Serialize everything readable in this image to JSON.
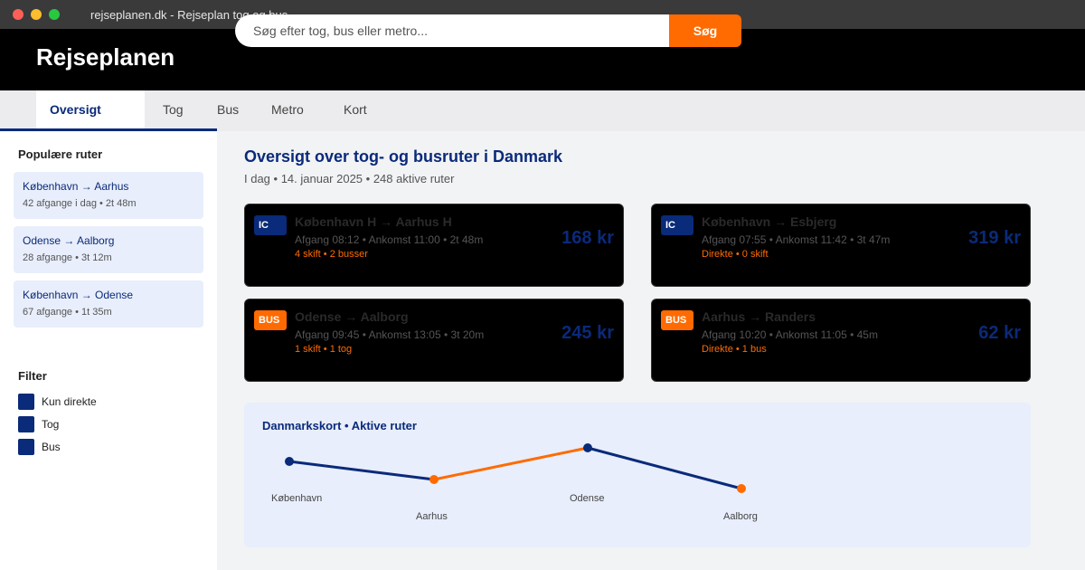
{
  "window": {
    "title": "rejseplanen.dk - Rejseplan tog og bus"
  },
  "header": {
    "logo": "Rejseplanen",
    "search_placeholder": "Søg efter tog, bus eller metro...",
    "search_button": "Søg"
  },
  "tabs": [
    {
      "label": "Oversigt",
      "active": true
    },
    {
      "label": "Tog"
    },
    {
      "label": "Bus"
    },
    {
      "label": "Metro"
    },
    {
      "label": "Kort"
    }
  ],
  "sidebar": {
    "popular_heading": "Populære ruter",
    "routes": [
      {
        "title": "København → Aarhus",
        "sub": "42 afgange i dag • 2t 48m"
      },
      {
        "title": "Odense → Aalborg",
        "sub": "28 afgange • 3t 12m"
      },
      {
        "title": "København → Odense",
        "sub": "67 afgange • 1t 35m"
      }
    ],
    "filter_heading": "Filter",
    "filters": [
      {
        "label": "Kun direkte"
      },
      {
        "label": "Tog"
      },
      {
        "label": "Bus"
      }
    ]
  },
  "main": {
    "title": "Oversigt over tog- og busruter i Danmark",
    "subtitle": "I dag • 14. januar 2025 • 248 aktive ruter",
    "cards": [
      {
        "badge": "IC",
        "type": "ic",
        "title": "København H → Aarhus H",
        "times": "Afgang 08:12 • Ankomst 11:00 • 2t 48m",
        "note": "4 skift • 2 busser",
        "price": "168 kr"
      },
      {
        "badge": "IC",
        "type": "ic",
        "title": "København → Esbjerg",
        "times": "Afgang 07:55 • Ankomst 11:42 • 3t 47m",
        "note": "Direkte • 0 skift",
        "price": "319 kr"
      },
      {
        "badge": "BUS",
        "type": "bus",
        "title": "Odense → Aalborg",
        "times": "Afgang 09:45 • Ankomst 13:05 • 3t 20m",
        "note": "1 skift • 1 tog",
        "price": "245 kr"
      },
      {
        "badge": "BUS",
        "type": "bus",
        "title": "Aarhus → Randers",
        "times": "Afgang 10:20 • Ankomst 11:05 • 45m",
        "note": "Direkte • 1 bus",
        "price": "62 kr"
      }
    ]
  },
  "map": {
    "title": "Danmarkskort • Aktive ruter",
    "cities": [
      {
        "name": "København",
        "color": "#0a2a7a"
      },
      {
        "name": "Aarhus",
        "color": "#ff6b00"
      },
      {
        "name": "Odense",
        "color": "#0a2a7a"
      },
      {
        "name": "Aalborg",
        "color": "#ff6b00"
      }
    ],
    "segment_colors": [
      "#0a2a7a",
      "#ff6b00",
      "#0a2a7a"
    ]
  },
  "colors": {
    "brand": "#0a2a7a",
    "accent": "#ff6b00"
  }
}
